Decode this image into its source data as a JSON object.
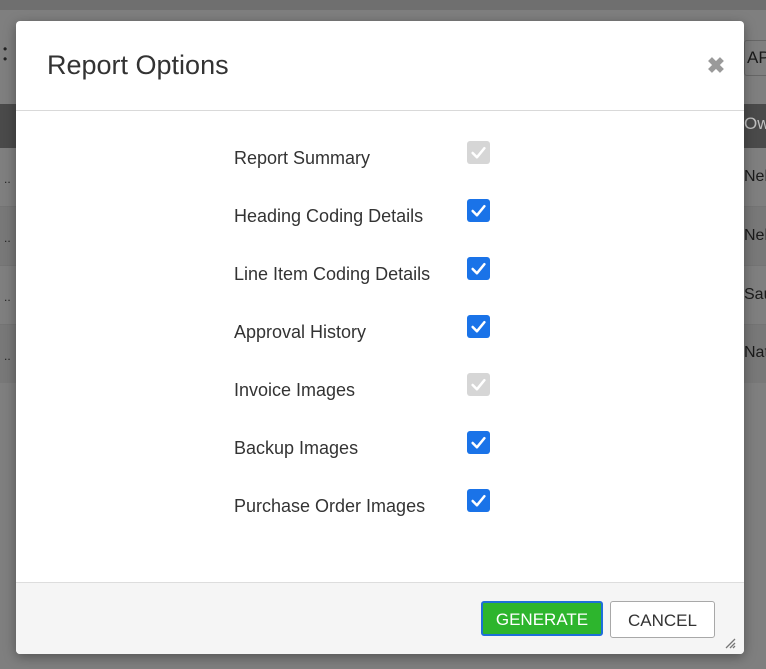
{
  "background": {
    "ap_button_label": "AP",
    "column_header": "Ow",
    "row_cells": [
      "Neh",
      "Neh",
      "Sau",
      "Nat"
    ]
  },
  "modal": {
    "title": "Report Options",
    "close_icon": "close-icon",
    "options": [
      {
        "label": "Report Summary",
        "checked": true,
        "disabled": true
      },
      {
        "label": "Heading Coding Details",
        "checked": true,
        "disabled": false
      },
      {
        "label": "Line Item Coding Details",
        "checked": true,
        "disabled": false
      },
      {
        "label": "Approval History",
        "checked": true,
        "disabled": false
      },
      {
        "label": "Invoice Images",
        "checked": true,
        "disabled": true
      },
      {
        "label": "Backup Images",
        "checked": true,
        "disabled": false
      },
      {
        "label": "Purchase Order Images",
        "checked": true,
        "disabled": false
      }
    ],
    "footer": {
      "generate_label": "GENERATE",
      "cancel_label": "CANCEL"
    }
  },
  "colors": {
    "checkbox_checked": "#1a73e8",
    "checkbox_disabled": "#d6d6d6",
    "generate_button": "#2db52d",
    "focus_outline": "#1e6fd9"
  }
}
